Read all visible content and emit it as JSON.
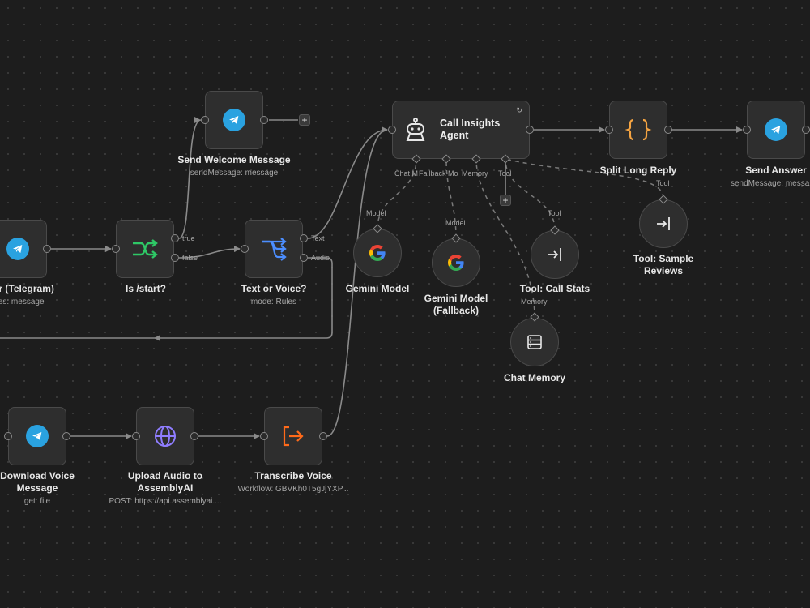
{
  "nodes": {
    "trigger": {
      "title": "gger (Telegram)",
      "subtitle": "ates: message"
    },
    "is_start": {
      "title": "Is /start?",
      "outputs": [
        "true",
        "false"
      ]
    },
    "send_welcome": {
      "title": "Send Welcome Message",
      "subtitle": "sendMessage: message"
    },
    "text_or_voice": {
      "title": "Text or Voice?",
      "subtitle": "mode: Rules",
      "outputs": [
        "Text",
        "Audio"
      ]
    },
    "agent": {
      "title": "Call Insights Agent",
      "ports": [
        "Chat M",
        "Fallback Mo",
        "Memory",
        "Tool"
      ]
    },
    "split": {
      "title": "Split Long Reply"
    },
    "send_answer": {
      "title": "Send Answer",
      "subtitle": "sendMessage: messa"
    },
    "gemini": {
      "title": "Gemini Model",
      "port_label": "Model"
    },
    "gemini_fb": {
      "title": "Gemini Model (Fallback)",
      "port_label": "Model"
    },
    "call_stats": {
      "title": "Tool: Call Stats",
      "port_label": "Tool"
    },
    "sample_reviews": {
      "title": "Tool: Sample Reviews",
      "port_label": "Tool"
    },
    "chat_memory": {
      "title": "Chat Memory",
      "port_label": "Memory"
    },
    "download": {
      "title": "Download Voice Message",
      "subtitle": "get: file"
    },
    "upload": {
      "title": "Upload Audio to AssemblyAI",
      "subtitle": "POST: https://api.assemblyai...."
    },
    "transcribe": {
      "title": "Transcribe Voice",
      "subtitle": "Workflow: GBVKh0T5gJjYXP..."
    }
  },
  "colors": {
    "telegram": "#2aa2e0",
    "if_green": "#2ec866",
    "switch_blue": "#4c8eff",
    "code_orange": "#f5a442",
    "http_purple": "#8f7dff",
    "exec_orange": "#ff6a1a"
  },
  "icons": {
    "telegram": "telegram-icon",
    "if": "branch-icon",
    "switch": "switch-icon",
    "agent": "robot-icon",
    "code": "braces-icon",
    "google": "google-icon",
    "tool": "tool-enter-icon",
    "memory": "database-icon",
    "http": "globe-icon",
    "exec": "execute-workflow-icon"
  }
}
